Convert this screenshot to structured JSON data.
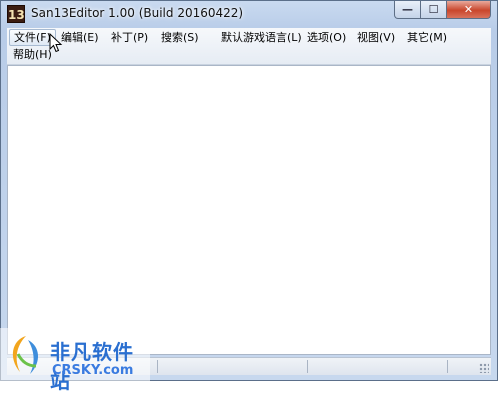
{
  "window": {
    "title": "San13Editor 1.00 (Build 20160422)",
    "icon_text": "13",
    "minimize_glyph": "—",
    "maximize_glyph": "☐",
    "close_glyph": "✕"
  },
  "menu": {
    "items": [
      {
        "label": "文件(F)",
        "state": "hover"
      },
      {
        "label": "编辑(E)"
      },
      {
        "label": "补丁(P)"
      },
      {
        "label": "搜索(S)"
      },
      {
        "label": "默认游戏语言(L)"
      },
      {
        "label": "选项(O)"
      },
      {
        "label": "视图(V)"
      },
      {
        "label": "其它(M)"
      },
      {
        "label": "帮助(H)"
      }
    ]
  },
  "watermark": {
    "title": "非凡软件站",
    "subtitle": "CRSKY.com"
  },
  "colors": {
    "title_gradient": "#c9daf0",
    "close_button": "#c9462c",
    "watermark_blue": "#2a6fd0"
  }
}
